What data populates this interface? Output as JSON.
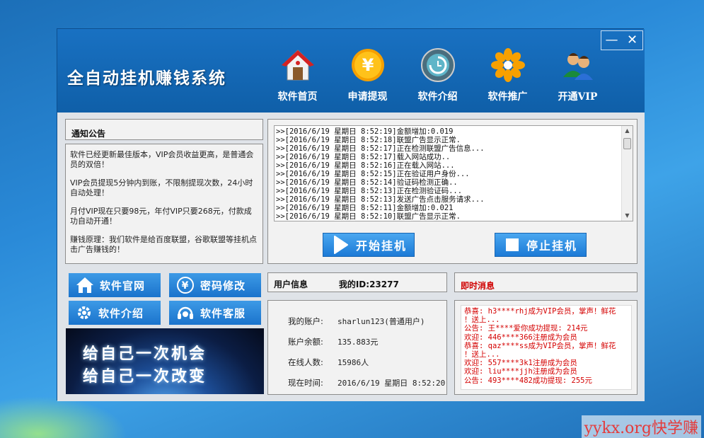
{
  "app": {
    "title": "全自动挂机赚钱系统",
    "window_controls": {
      "minimize": "—",
      "close": "✕"
    }
  },
  "nav": [
    {
      "label": "软件首页",
      "icon": "home-icon"
    },
    {
      "label": "申请提现",
      "icon": "yen-coin-icon"
    },
    {
      "label": "软件介绍",
      "icon": "refresh-clock-icon"
    },
    {
      "label": "软件推广",
      "icon": "flower-icon"
    },
    {
      "label": "开通VIP",
      "icon": "users-icon"
    }
  ],
  "notice": {
    "title": "通知公告",
    "paragraphs": [
      "软件已经更新最佳版本，VIP会员收益更高，是普通会员的双倍！",
      "VIP会员提现5分钟内到账，不限制提现次数，24小时自动处理！",
      "月付VIP现在只要98元，年付VIP只要268元，付款成功自动开通！",
      "赚钱原理：我们软件是给百度联盟，谷歌联盟等挂机点击广告赚钱的！"
    ]
  },
  "log": {
    "lines": [
      ">>[2016/6/19 星期日 8:52:19]金额增加:0.019",
      ">>[2016/6/19 星期日 8:52:18]联盟广告显示正常.",
      ">>[2016/6/19 星期日 8:52:17]正在检测联盟广告信息...",
      ">>[2016/6/19 星期日 8:52:17]载入网站成功..",
      ">>[2016/6/19 星期日 8:52:16]正在载入网站...",
      ">>[2016/6/19 星期日 8:52:15]正在验证用户身份...",
      ">>[2016/6/19 星期日 8:52:14]验证码检测正确..",
      ">>[2016/6/19 星期日 8:52:13]正在检测验证码...",
      ">>[2016/6/19 星期日 8:52:13]发送广告点击服务请求...",
      ">>[2016/6/19 星期日 8:52:11]金额增加:0.021",
      ">>[2016/6/19 星期日 8:52:10]联盟广告显示正常."
    ],
    "scroll_up": "▲",
    "scroll_down": "▼"
  },
  "actions": {
    "start": "开始挂机",
    "stop": "停止挂机"
  },
  "side_buttons": [
    {
      "label": "软件官网",
      "icon": "home-icon"
    },
    {
      "label": "密码修改",
      "icon": "yen-icon"
    },
    {
      "label": "软件介绍",
      "icon": "gear-icon"
    },
    {
      "label": "软件客服",
      "icon": "headset-icon"
    }
  ],
  "banner": {
    "line1": "给自己一次机会",
    "line2": "给自己一次改变"
  },
  "user_info": {
    "title": "用户信息",
    "id_text": "我的ID:23277",
    "rows": [
      {
        "label": "我的账户:",
        "value": "sharlun123(普通用户)"
      },
      {
        "label": "账户余额:",
        "value": "135.883元"
      },
      {
        "label": "在线人数:",
        "value": "15986人"
      },
      {
        "label": "现在时间:",
        "value": "2016/6/19 星期日 8:52:20"
      }
    ]
  },
  "messages": {
    "title": "即时消息",
    "lines": [
      "恭喜: h3****rhj成为VIP会员，掌声！鲜花",
      "！送上...",
      "公告: 王****爱你成功提现: 214元",
      "欢迎: 446****366注册成为会员",
      "恭喜: qaz****ss成为VIP会员，掌声！鲜花",
      "！送上...",
      "欢迎: 557****3k1注册成为会员",
      "欢迎: liu****jjh注册成为会员",
      "公告: 493****482成功提现: 255元"
    ]
  },
  "watermark": "yykx.org快学赚"
}
